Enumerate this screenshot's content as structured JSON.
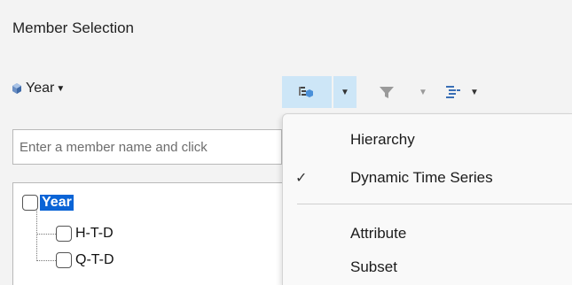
{
  "panel": {
    "title": "Member Selection"
  },
  "toolbar": {
    "dimension_label": "Year",
    "dimension_icon": "cube-icon",
    "buttons": [
      {
        "name": "member-view-button",
        "icon": "hierarchy-view-icon",
        "active": true
      },
      {
        "name": "filter-button",
        "icon": "filter-icon",
        "active": false
      },
      {
        "name": "layout-button",
        "icon": "list-layout-icon",
        "active": false
      }
    ]
  },
  "search": {
    "placeholder": "Enter a member name and click"
  },
  "tree": {
    "root": {
      "label": "Year",
      "checked": false,
      "selected": true
    },
    "children": [
      {
        "label": "H-T-D",
        "checked": false
      },
      {
        "label": "Q-T-D",
        "checked": false
      }
    ]
  },
  "menu": {
    "items": [
      {
        "label": "Hierarchy",
        "checked": false
      },
      {
        "label": "Dynamic Time Series",
        "checked": true
      },
      {
        "label": "Attribute",
        "checked": false
      },
      {
        "label": "Subset",
        "checked": false
      }
    ],
    "check_glyph": "✓"
  },
  "colors": {
    "active_button_bg": "#cde6f7",
    "selection_bg": "#0a64d6",
    "icon_blue": "#4a90d9"
  }
}
